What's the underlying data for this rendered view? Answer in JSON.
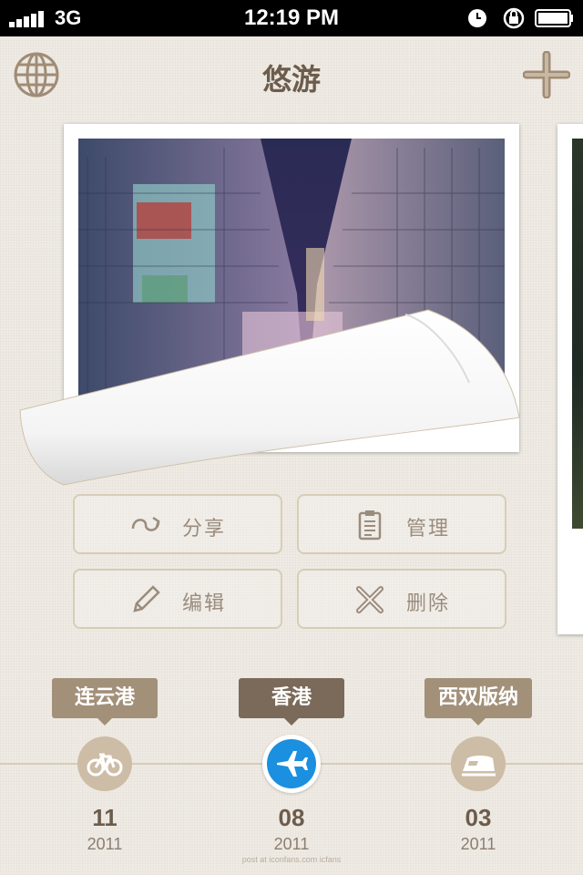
{
  "status_bar": {
    "carrier": "3G",
    "time": "12:19 PM"
  },
  "header": {
    "title": "悠游",
    "left_icon": "globe-icon",
    "right_icon": "plus-icon"
  },
  "actions": [
    {
      "label": "分享",
      "icon": "share-icon"
    },
    {
      "label": "管理",
      "icon": "clipboard-icon"
    },
    {
      "label": "编辑",
      "icon": "pencil-icon"
    },
    {
      "label": "删除",
      "icon": "cross-icon"
    }
  ],
  "timeline": [
    {
      "place": "连云港",
      "day": "11",
      "year": "2011",
      "icon": "bicycle-icon",
      "selected": false
    },
    {
      "place": "香港",
      "day": "08",
      "year": "2011",
      "icon": "airplane-icon",
      "selected": true
    },
    {
      "place": "西双版纳",
      "day": "03",
      "year": "2011",
      "icon": "train-icon",
      "selected": false
    }
  ],
  "colors": {
    "accent": "#1b8fe0",
    "pin": "#a29079",
    "pin_selected": "#7b6a59",
    "text": "#6d5c4c",
    "node": "#cdbda6"
  },
  "watermark": "post at iconfans.com  icfans"
}
